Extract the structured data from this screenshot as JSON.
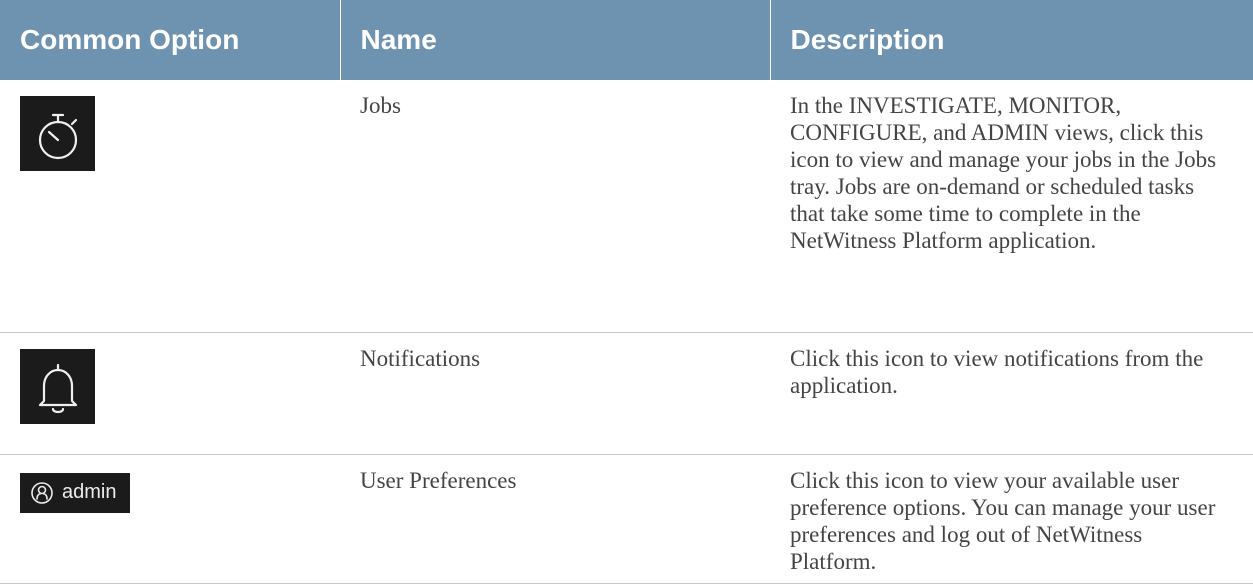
{
  "table": {
    "headers": [
      "Common Option",
      "Name",
      "Description"
    ],
    "rows": [
      {
        "icon": "stopwatch-icon",
        "name": "Jobs",
        "description": "In the INVESTIGATE, MONITOR, CONFIGURE, and ADMIN views, click this icon to view and manage your jobs in the Jobs tray. Jobs are on-demand or scheduled tasks that take some time to complete in the NetWitness Platform application."
      },
      {
        "icon": "bell-icon",
        "name": "Notifications",
        "description": "Click this icon to view notifications from the application."
      },
      {
        "icon": "user-icon",
        "icon_label": "admin",
        "name": "User Preferences",
        "description": "Click this icon to view your available user preference options. You can manage your user preferences and log out of NetWitness Platform."
      }
    ]
  },
  "colors": {
    "header_background": "#6d93b0",
    "header_text": "#ffffff",
    "body_text": "#444444",
    "icon_background": "#1b1b1b"
  }
}
